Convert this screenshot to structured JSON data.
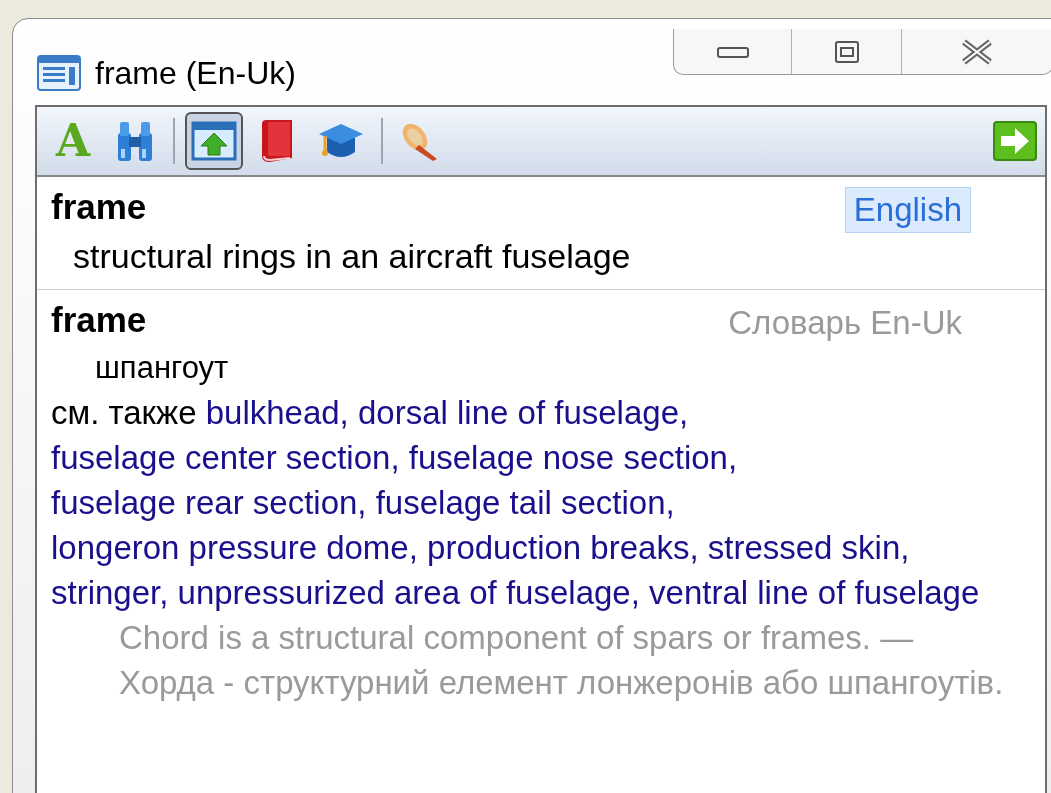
{
  "window": {
    "title": "frame (En-Uk)"
  },
  "toolbar": {
    "buttons": [
      {
        "kind": "letter",
        "label": "A",
        "selected": false
      },
      {
        "kind": "binoculars",
        "selected": false
      },
      {
        "kind": "separator"
      },
      {
        "kind": "panel-up",
        "selected": true
      },
      {
        "kind": "book",
        "selected": false
      },
      {
        "kind": "cap",
        "selected": false
      },
      {
        "kind": "separator"
      },
      {
        "kind": "horn",
        "selected": false
      }
    ],
    "end_button": {
      "kind": "arrow"
    }
  },
  "entries": [
    {
      "headword": "frame",
      "source": "English",
      "source_selected": true,
      "definition": "structural rings in an aircraft fuselage"
    },
    {
      "headword": "frame",
      "source": "Словарь En-Uk",
      "source_selected": false,
      "translation": "шпангоут",
      "see_also_label": "см. также",
      "see_also": [
        "bulkhead,",
        "dorsal line of fuselage,",
        "fuselage center section,",
        "fuselage nose section,",
        "fuselage rear section,",
        "fuselage tail section,",
        "longeron pressure dome,",
        "production breaks,",
        "stressed skin,",
        "stringer,",
        "unpressurized area of fuselage,",
        "ventral line of fuselage"
      ],
      "example": "Chord is a structural component of spars or frames. — Хорда - структурний елемент лонжеронів або шпангоутів."
    }
  ]
}
